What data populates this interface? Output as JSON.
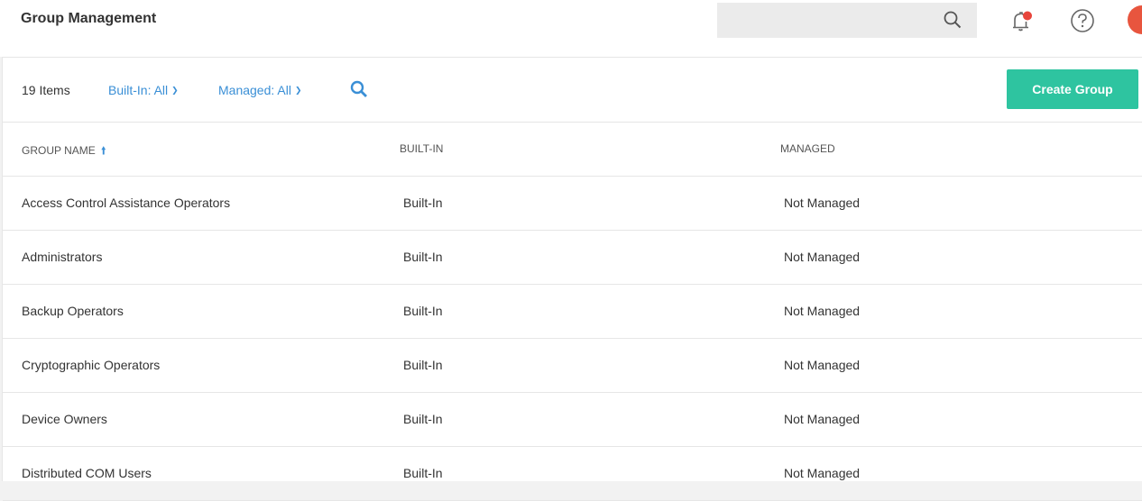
{
  "header": {
    "title": "Group Management",
    "search_placeholder": ""
  },
  "toolbar": {
    "item_count": "19 Items",
    "builtin_filter": "Built-In: All",
    "managed_filter": "Managed: All",
    "create_label": "Create Group"
  },
  "table": {
    "columns": [
      "GROUP NAME",
      "BUILT-IN",
      "MANAGED"
    ],
    "sort_column": "GROUP NAME",
    "sort_direction": "ascending",
    "rows": [
      {
        "name": "Access Control Assistance Operators",
        "builtin": "Built-In",
        "managed": "Not Managed"
      },
      {
        "name": "Administrators",
        "builtin": "Built-In",
        "managed": "Not Managed"
      },
      {
        "name": "Backup Operators",
        "builtin": "Built-In",
        "managed": "Not Managed"
      },
      {
        "name": "Cryptographic Operators",
        "builtin": "Built-In",
        "managed": "Not Managed"
      },
      {
        "name": "Device Owners",
        "builtin": "Built-In",
        "managed": "Not Managed"
      },
      {
        "name": "Distributed COM Users",
        "builtin": "Built-In",
        "managed": "Not Managed"
      }
    ]
  },
  "icons": [
    "search-icon",
    "bell-icon",
    "help-icon",
    "avatar",
    "filter-chevron-icon",
    "sort-arrow-icon"
  ],
  "colors": {
    "accent": "#3a8fd6",
    "create_button": "#2ec4a0",
    "notification_dot": "#e8453c",
    "avatar": "#e8553e"
  }
}
